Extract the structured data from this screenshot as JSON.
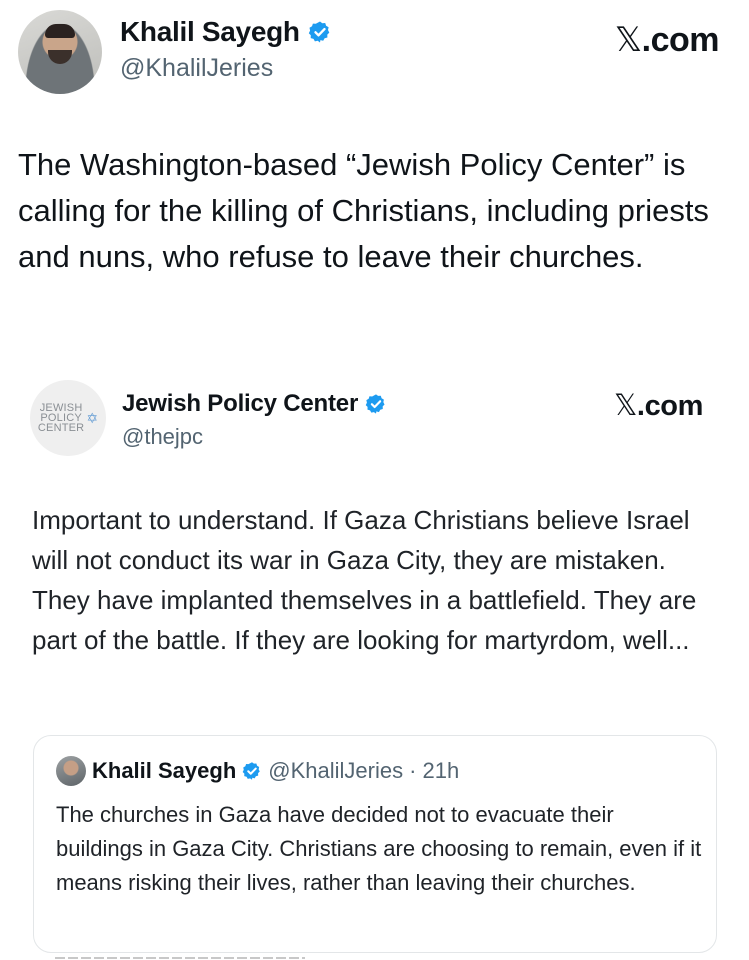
{
  "main_tweet": {
    "author_name": "Khalil Sayegh",
    "handle": "@KhalilJeries",
    "source": "X.com",
    "text": "The Washington-based “Jewish Policy Center” is calling for the killing of Christians, including priests and nuns, who refuse to leave their churches."
  },
  "embedded_tweet": {
    "author_name": "Jewish Policy Center",
    "handle": "@thejpc",
    "source": "X.com",
    "logo_lines": [
      "JEWISH",
      "POLICY",
      "CENTER"
    ],
    "text": "Important to understand. If Gaza Christians believe Israel will not conduct its war in Gaza City, they are mistaken. They have implanted themselves in a battlefield. They are part of the battle. If they are looking for martyrdom, well..."
  },
  "quoted_tweet": {
    "author_name": "Khalil Sayegh",
    "handle": "@KhalilJeries",
    "time": "· 21h",
    "text": "The churches in Gaza have decided not to evacuate their buildings in Gaza City. Christians are choosing to remain, even if it means risking their lives, rather than leaving their churches."
  },
  "icons": {
    "verified": "verified-badge-icon",
    "star": "star-of-david-icon"
  },
  "colors": {
    "verified_blue": "#1d9bf0",
    "text": "#0f1419",
    "muted": "#536471"
  }
}
